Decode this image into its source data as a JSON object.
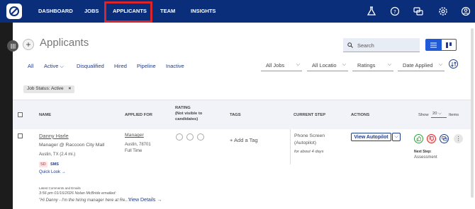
{
  "nav": {
    "items": [
      "DASHBOARD",
      "JOBS",
      "APPLICANTS",
      "TEAM",
      "INSIGHTS"
    ],
    "active": "APPLICANTS"
  },
  "page": {
    "title": "Applicants",
    "search_placeholder": "Search"
  },
  "filters": {
    "tabs": [
      "All",
      "Active",
      "Disqualified",
      "Hired",
      "Pipeline",
      "Inactive"
    ],
    "dropdowns": [
      "All Jobs",
      "All Locatio",
      "Ratings",
      "Date Applied"
    ],
    "chip": "Job Status: Active",
    "chip_close": "×"
  },
  "table": {
    "headers": {
      "name": "NAME",
      "applied_for": "APPLIED FOR",
      "rating": "RATING",
      "rating_sub1": "(Not visible to",
      "rating_sub2": "candidates)",
      "tags": "TAGS",
      "current_step": "CURRENT STEP",
      "actions": "ACTIONS",
      "show": "Show",
      "show_count": "20",
      "items": "Items"
    },
    "row": {
      "name": "Danny Harle",
      "title": "Manager @ Raccoon City Mall",
      "location": "Austin, TX (2.4 mi.)",
      "badge_sd": "SD",
      "badge_sms": "SMS",
      "quick_look": "Quick Look →",
      "job": "Manager",
      "job_loc": "Austin, 78701",
      "job_type": "Full Time",
      "add_tag": "+ Add a Tag",
      "step1": "Phone Screen",
      "step2": "(Autopilot)",
      "step_time": "for about 4 days",
      "view_autopilot": "View Autopilot",
      "next_step_label": "Next Step:",
      "next_step": "Assessment",
      "comments_title": "Latest Comments and Emails",
      "comment_meta": "3:56 pm 01/16/2026 Nolan McBride emailed:",
      "comment_text": "\"Hi Danny - I'm the hiring manager here at Re...\"",
      "view_details": "View Details →"
    }
  },
  "colors": {
    "nav_bg": "#0b2e7a",
    "accent": "#1f3c8a",
    "highlight": "#d9262c"
  }
}
